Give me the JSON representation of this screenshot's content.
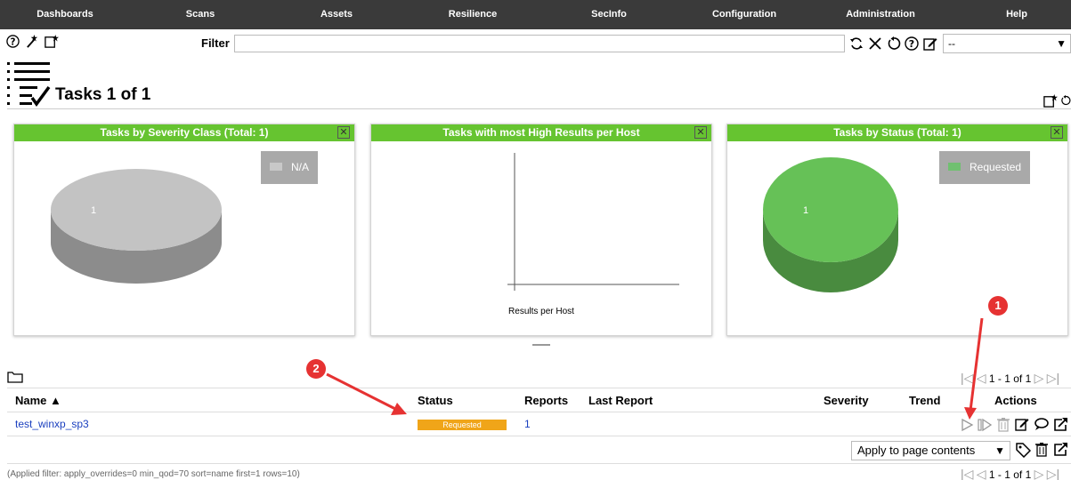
{
  "nav": [
    "Dashboards",
    "Scans",
    "Assets",
    "Resilience",
    "SecInfo",
    "Configuration",
    "Administration",
    "Help"
  ],
  "toolbar": {
    "icons": [
      "help-icon",
      "wizard-icon",
      "new-task-icon"
    ]
  },
  "filter": {
    "label": "Filter",
    "value": "",
    "select_value": "--",
    "icons": [
      "refresh-icon",
      "clear-icon",
      "reset-icon",
      "help-icon",
      "edit-icon"
    ]
  },
  "page": {
    "title": "Tasks 1 of 1"
  },
  "charts": [
    {
      "title": "Tasks by Severity Class (Total: 1)",
      "close": "✕",
      "legend": "N/A",
      "legend_color": "#c8c8c8",
      "color": "#c3c3c3",
      "label": "1"
    },
    {
      "title": "Tasks with most High Results per Host",
      "close": "✕",
      "xlabel": "Results per Host"
    },
    {
      "title": "Tasks by Status (Total: 1)",
      "close": "✕",
      "legend": "Requested",
      "legend_color": "#70c070",
      "color": "#66c157",
      "label": "1"
    }
  ],
  "chart_data": [
    {
      "type": "pie",
      "title": "Tasks by Severity Class (Total: 1)",
      "categories": [
        "N/A"
      ],
      "values": [
        1
      ]
    },
    {
      "type": "bar",
      "title": "Tasks with most High Results per Host",
      "xlabel": "Results per Host",
      "categories": [],
      "values": []
    },
    {
      "type": "pie",
      "title": "Tasks by Status (Total: 1)",
      "categories": [
        "Requested"
      ],
      "values": [
        1
      ]
    }
  ],
  "pagination": {
    "text": "1 - 1 of 1"
  },
  "table": {
    "columns": {
      "name": "Name ▲",
      "status": "Status",
      "reports": "Reports",
      "last_report": "Last Report",
      "severity": "Severity",
      "trend": "Trend",
      "actions": "Actions"
    },
    "rows": [
      {
        "name": "test_winxp_sp3",
        "status": "Requested",
        "reports": "1",
        "last_report": "",
        "severity": "",
        "trend": ""
      }
    ]
  },
  "bulk": {
    "select_value": "Apply to page contents"
  },
  "footer": "(Applied filter: apply_overrides=0 min_qod=70 sort=name first=1 rows=10)",
  "markers": [
    "1",
    "2"
  ]
}
